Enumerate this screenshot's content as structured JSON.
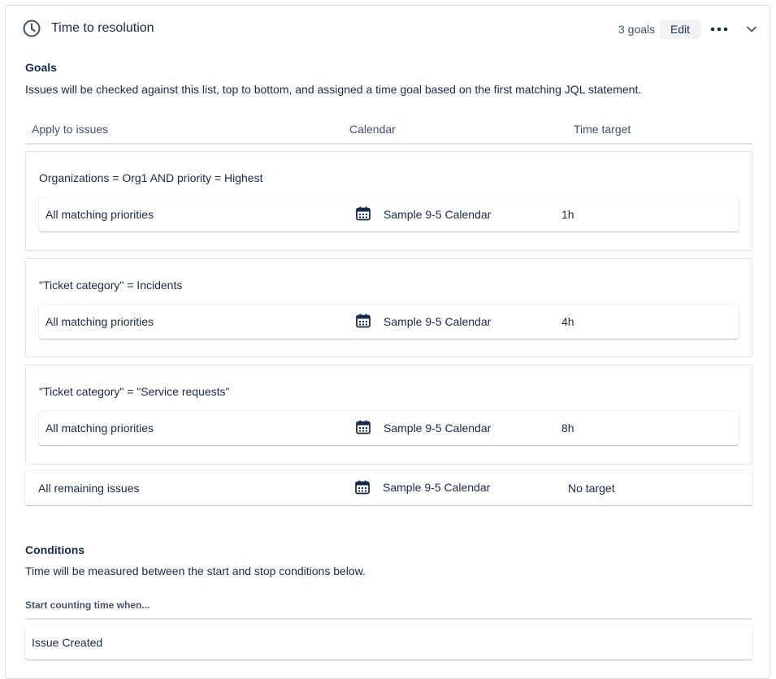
{
  "header": {
    "title": "Time to resolution",
    "goals_count": "3 goals",
    "edit_label": "Edit"
  },
  "goals_section": {
    "heading": "Goals",
    "description": "Issues will be checked against this list, top to bottom, and assigned a time goal based on the first matching JQL statement.",
    "columns": [
      "Apply to issues",
      "Calendar",
      "Time target"
    ]
  },
  "goal_groups": [
    {
      "jql": "Organizations = Org1 AND priority = Highest",
      "row": {
        "issues": "All matching priorities",
        "calendar": "Sample 9-5 Calendar",
        "target": "1h"
      }
    },
    {
      "jql": "\"Ticket category\" = Incidents",
      "row": {
        "issues": "All matching priorities",
        "calendar": "Sample 9-5 Calendar",
        "target": "4h"
      }
    },
    {
      "jql": "\"Ticket category\" = \"Service requests\"",
      "row": {
        "issues": "All matching priorities",
        "calendar": "Sample 9-5 Calendar",
        "target": "8h"
      }
    }
  ],
  "remaining": {
    "issues": "All remaining issues",
    "calendar": "Sample 9-5 Calendar",
    "target": "No target"
  },
  "conditions": {
    "heading": "Conditions",
    "description": "Time will be measured between the start and stop conditions below.",
    "start_label": "Start counting time when...",
    "start_conditions": [
      "Issue Created"
    ]
  },
  "icons": {
    "header": "clock-icon",
    "more": "more-icon",
    "collapse": "chevron-down-icon",
    "calendar": "calendar-icon"
  },
  "colors": {
    "text": "#172b4d",
    "subtle_text": "#42526e",
    "border": "#dfe1e6",
    "button_bg": "#f1f2f4"
  }
}
